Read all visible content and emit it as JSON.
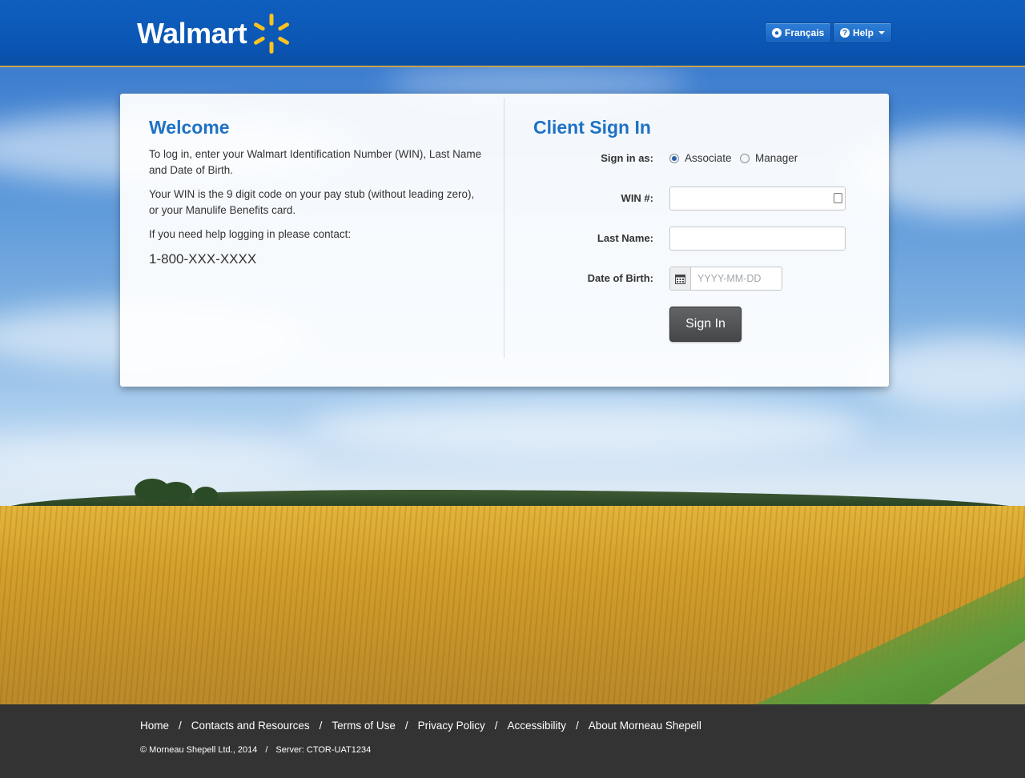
{
  "header": {
    "logo_text": "Walmart",
    "lang_button": "Français",
    "help_button": "Help"
  },
  "welcome": {
    "title": "Welcome",
    "para1": "To log in, enter your Walmart Identification Number (WIN), Last Name and Date of Birth.",
    "para2": "Your WIN is the 9 digit code on your pay stub (without leading zero), or your Manulife Benefits card.",
    "para3": "If you need help logging in please contact:",
    "phone": "1-800-XXX-XXXX"
  },
  "signin": {
    "title": "Client Sign In",
    "sign_in_as_label": "Sign in as:",
    "role_options": [
      "Associate",
      "Manager"
    ],
    "selected_role": "Associate",
    "win_label": "WIN #:",
    "win_value": "",
    "last_name_label": "Last Name:",
    "last_name_value": "",
    "dob_label": "Date of Birth:",
    "dob_placeholder": "YYYY-MM-DD",
    "submit_label": "Sign In"
  },
  "footer": {
    "links": [
      "Home",
      "Contacts and Resources",
      "Terms of Use",
      "Privacy Policy",
      "Accessibility",
      "About Morneau Shepell"
    ],
    "copyright": "© Morneau Shepell Ltd., 2014",
    "server": "Server: CTOR-UAT1234",
    "separator": "/"
  },
  "colors": {
    "header_blue": "#0b57b5",
    "heading_blue": "#1f72c4",
    "spark_yellow": "#ffc220",
    "button_dark": "#4a4c4e",
    "footer_bg": "#333333"
  }
}
